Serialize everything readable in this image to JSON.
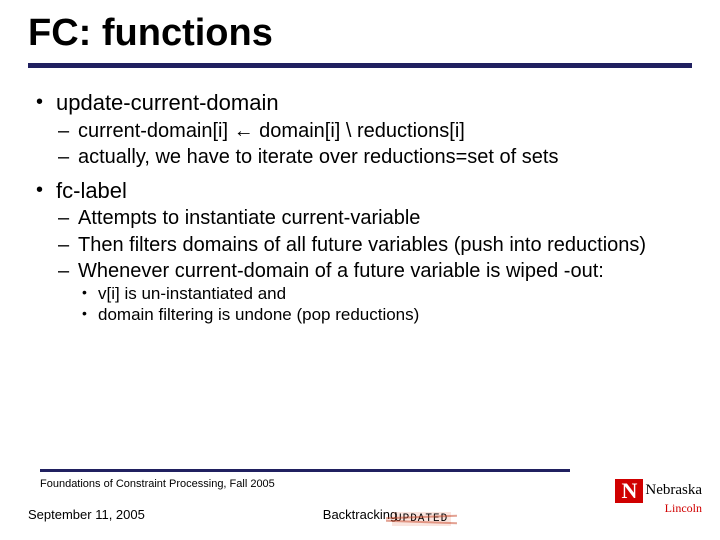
{
  "title": "FC: functions",
  "bullets": {
    "b1": {
      "label": "update-current-domain",
      "sub1": "current-domain[i] ← domain[i] \\ reductions[i]",
      "sub2": "actually, we have to iterate over reductions=set of sets"
    },
    "b2": {
      "label": "fc-label",
      "sub1": "Attempts to instantiate current-variable",
      "sub2": "Then filters domains of all future variables (push into reductions)",
      "sub3": "Whenever current-domain of a future variable is wiped -out:",
      "subsub1": "v[i] is un-instantiated and",
      "subsub2": "domain filtering is undone (pop reductions)"
    }
  },
  "footer": {
    "course": "Foundations of Constraint Processing, Fall 2005",
    "date": "September 11, 2005",
    "center": "Backtracking",
    "badge": "UPDATED"
  },
  "logo": {
    "n": "N",
    "text": "Nebraska",
    "sub": "Lincoln"
  }
}
